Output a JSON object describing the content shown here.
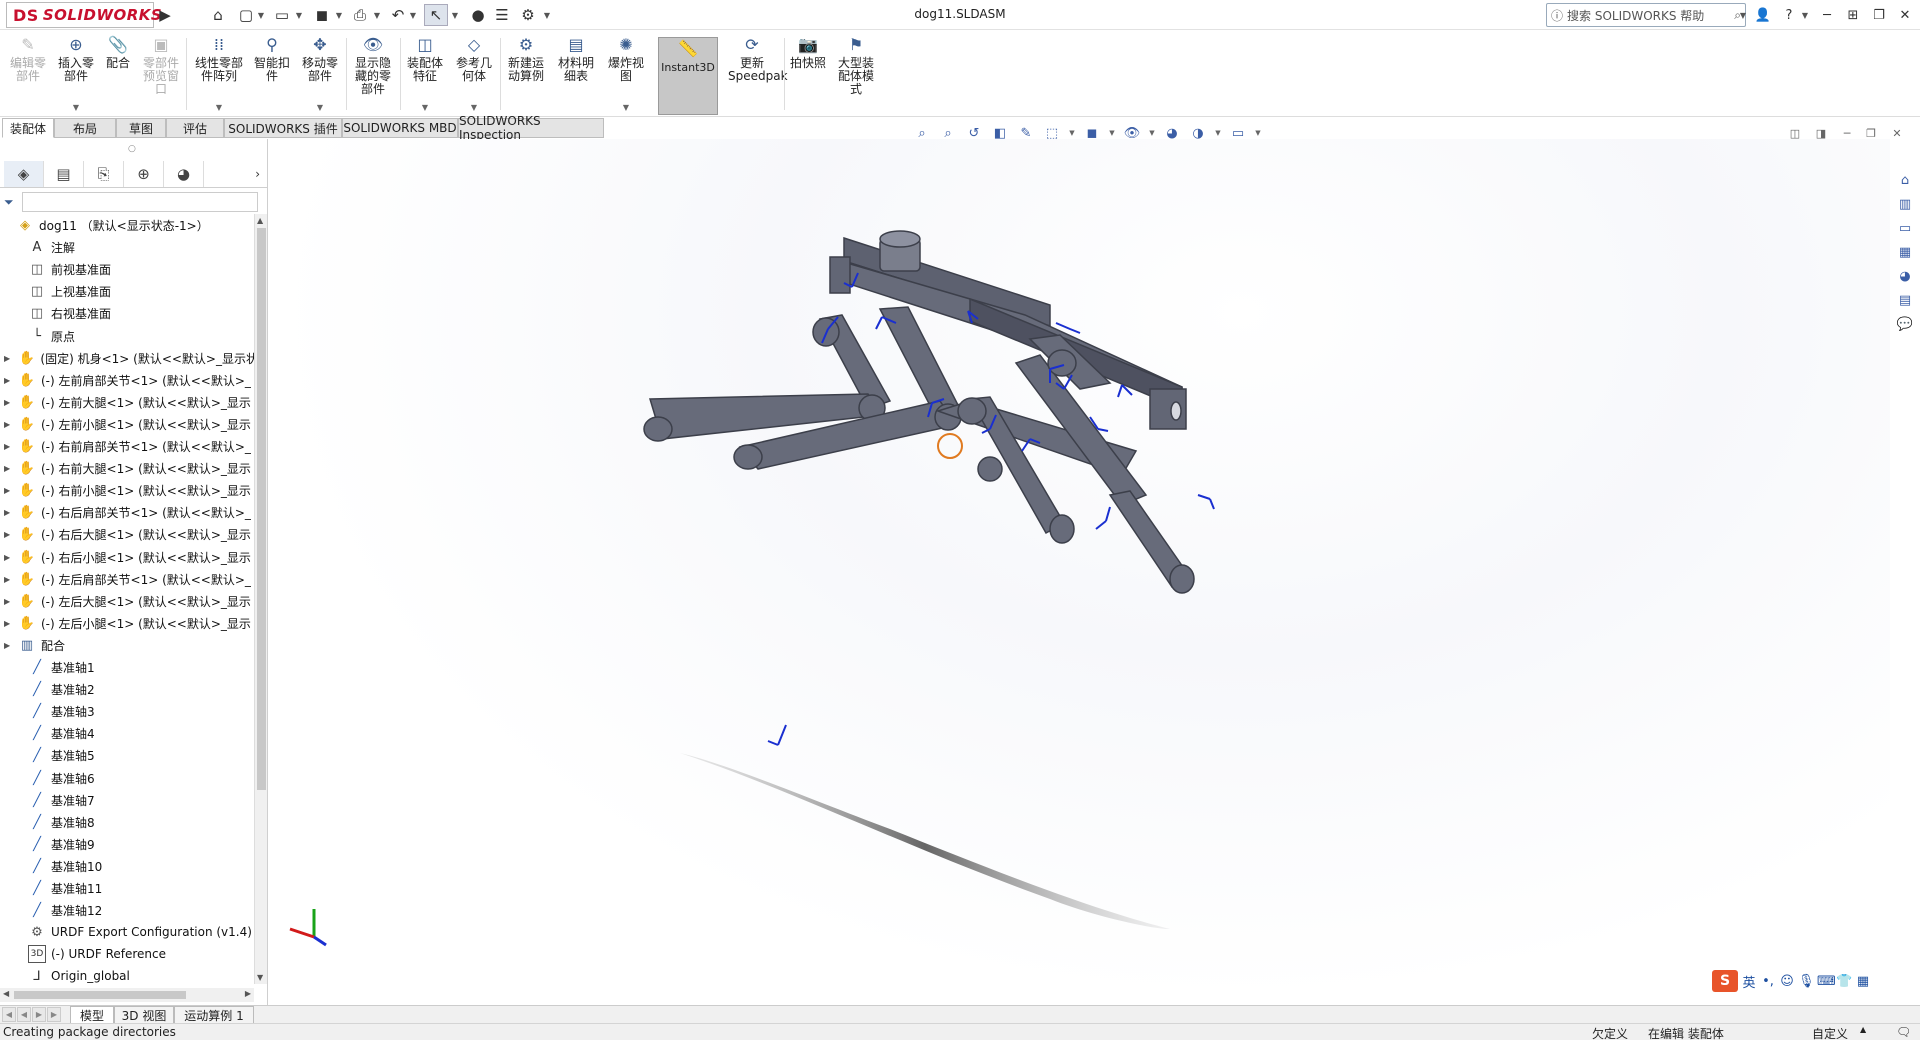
{
  "app": {
    "brand": "SOLIDWORKS",
    "brand_prefix": "DS",
    "document_title": "dog11.SLDASM"
  },
  "search": {
    "placeholder": "搜索 SOLIDWORKS 帮助"
  },
  "commands": [
    {
      "label": "编辑零部件",
      "icon": "edit-component-icon",
      "disabled": true
    },
    {
      "label": "插入零部件",
      "icon": "insert-component-icon"
    },
    {
      "label": "配合",
      "icon": "mate-icon"
    },
    {
      "label": "零部件预览窗口",
      "icon": "component-preview-icon",
      "disabled": true
    },
    {
      "label": "线性零部件阵列",
      "icon": "linear-pattern-icon"
    },
    {
      "label": "智能扣件",
      "icon": "smart-fastener-icon"
    },
    {
      "label": "移动零部件",
      "icon": "move-component-icon"
    },
    {
      "label": "显示隐藏的零部件",
      "icon": "show-hidden-icon"
    },
    {
      "label": "装配体特征",
      "icon": "assembly-feature-icon"
    },
    {
      "label": "参考几何体",
      "icon": "reference-geometry-icon"
    },
    {
      "label": "新建运动算例",
      "icon": "motion-study-icon"
    },
    {
      "label": "材料明细表",
      "icon": "bom-icon"
    },
    {
      "label": "爆炸视图",
      "icon": "exploded-view-icon"
    },
    {
      "label": "Instant3D",
      "icon": "instant3d-icon",
      "active": true
    },
    {
      "label": "更新Speedpak",
      "icon": "speedpak-icon"
    },
    {
      "label": "拍快照",
      "icon": "snapshot-icon"
    },
    {
      "label": "大型装配体模式",
      "icon": "large-assembly-icon"
    }
  ],
  "cm_tabs": [
    "装配体",
    "布局",
    "草图",
    "评估",
    "SOLIDWORKS 插件",
    "SOLIDWORKS MBD",
    "SOLIDWORKS Inspection"
  ],
  "tree": {
    "root": "dog11 （默认<显示状态-1>）",
    "items": [
      {
        "label": "注解",
        "icon": "annotation-icon"
      },
      {
        "label": "前视基准面",
        "icon": "plane-icon"
      },
      {
        "label": "上视基准面",
        "icon": "plane-icon"
      },
      {
        "label": "右视基准面",
        "icon": "plane-icon"
      },
      {
        "label": "原点",
        "icon": "origin-icon"
      },
      {
        "label": "(固定) 机身<1> (默认<<默认>_显示状",
        "icon": "part-icon"
      },
      {
        "label": "(-) 左前肩部关节<1> (默认<<默认>_",
        "icon": "part-icon"
      },
      {
        "label": "(-) 左前大腿<1> (默认<<默认>_显示",
        "icon": "part-icon"
      },
      {
        "label": "(-) 左前小腿<1> (默认<<默认>_显示",
        "icon": "part-icon"
      },
      {
        "label": "(-) 右前肩部关节<1> (默认<<默认>_",
        "icon": "part-icon"
      },
      {
        "label": "(-) 右前大腿<1> (默认<<默认>_显示",
        "icon": "part-icon"
      },
      {
        "label": "(-) 右前小腿<1> (默认<<默认>_显示",
        "icon": "part-icon"
      },
      {
        "label": "(-) 右后肩部关节<1> (默认<<默认>_",
        "icon": "part-icon"
      },
      {
        "label": "(-) 右后大腿<1> (默认<<默认>_显示",
        "icon": "part-icon"
      },
      {
        "label": "(-) 右后小腿<1> (默认<<默认>_显示",
        "icon": "part-icon"
      },
      {
        "label": "(-) 左后肩部关节<1> (默认<<默认>_",
        "icon": "part-icon"
      },
      {
        "label": "(-) 左后大腿<1> (默认<<默认>_显示",
        "icon": "part-icon"
      },
      {
        "label": "(-) 左后小腿<1> (默认<<默认>_显示",
        "icon": "part-icon"
      },
      {
        "label": "配合",
        "icon": "mates-folder-icon"
      },
      {
        "label": "基准轴1",
        "icon": "axis-icon"
      },
      {
        "label": "基准轴2",
        "icon": "axis-icon"
      },
      {
        "label": "基准轴3",
        "icon": "axis-icon"
      },
      {
        "label": "基准轴4",
        "icon": "axis-icon"
      },
      {
        "label": "基准轴5",
        "icon": "axis-icon"
      },
      {
        "label": "基准轴6",
        "icon": "axis-icon"
      },
      {
        "label": "基准轴7",
        "icon": "axis-icon"
      },
      {
        "label": "基准轴8",
        "icon": "axis-icon"
      },
      {
        "label": "基准轴9",
        "icon": "axis-icon"
      },
      {
        "label": "基准轴10",
        "icon": "axis-icon"
      },
      {
        "label": "基准轴11",
        "icon": "axis-icon"
      },
      {
        "label": "基准轴12",
        "icon": "axis-icon"
      },
      {
        "label": "URDF Export Configuration (v1.4)",
        "icon": "urdf-config-icon"
      },
      {
        "label": "(-) URDF Reference",
        "icon": "3d-sketch-icon"
      },
      {
        "label": "Origin_global",
        "icon": "coordinate-system-icon"
      }
    ]
  },
  "bottom_tabs": [
    "模型",
    "3D 视图",
    "运动算例 1"
  ],
  "status": {
    "left": "Creating package directories",
    "underdefined": "欠定义",
    "editing": "在编辑 装配体",
    "custom": "自定义"
  },
  "ime": {
    "lang": "英"
  },
  "colors": {
    "brand": "#c8102e",
    "model": "#5a5e6e",
    "axis_blue": "#1a2fd0"
  }
}
